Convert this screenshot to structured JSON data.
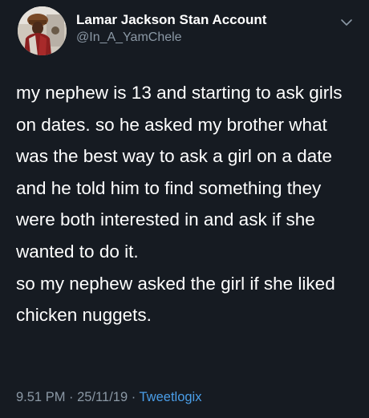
{
  "user": {
    "display_name": "Lamar Jackson Stan Account",
    "handle": "@In_A_YamChele",
    "avatar_icon": "profile-photo"
  },
  "tweet": {
    "paragraph_1": "my nephew is 13 and starting to ask girls on dates. so he asked my brother what was the best way to ask a girl on a date and he told him to find something they were both interested in and ask if she wanted to do it.",
    "paragraph_2": "so my nephew asked the girl if she liked chicken nuggets."
  },
  "meta": {
    "time": "9.51 PM",
    "separator_1": " · ",
    "date": "25/11/19",
    "separator_2": " · ",
    "client": "Tweetlogix"
  },
  "menu": {
    "icon": "chevron-down-icon"
  },
  "colors": {
    "background": "#161b22",
    "text": "#ffffff",
    "secondary": "#8b98a5",
    "link": "#4a9ee8"
  }
}
